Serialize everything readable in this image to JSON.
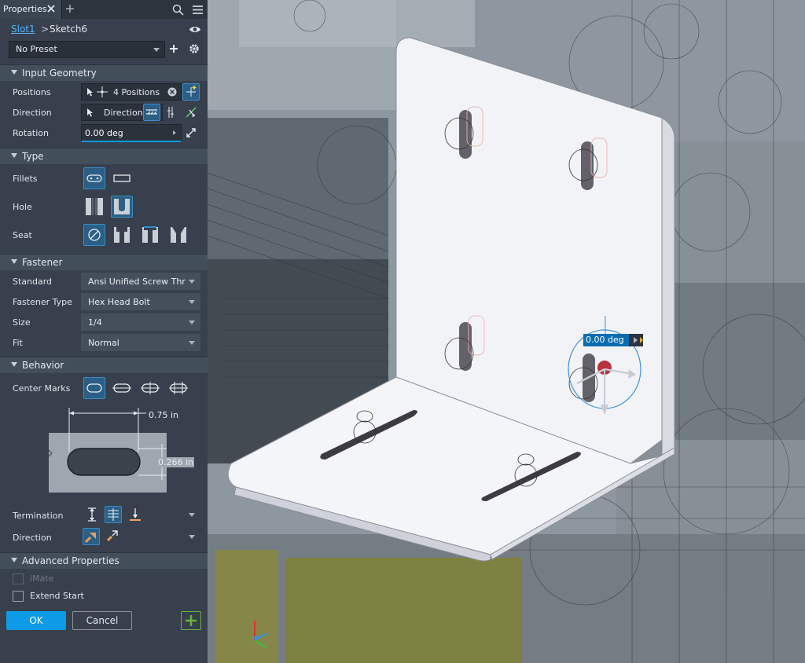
{
  "panel": {
    "tab_title": "Properties",
    "breadcrumb": {
      "item1": "Slot1",
      "separator": ">",
      "item2": "Sketch6"
    },
    "preset": {
      "value": "No Preset"
    }
  },
  "input_geometry": {
    "title": "Input Geometry",
    "positions_label": "Positions",
    "positions_value": "4 Positions",
    "direction_label": "Direction",
    "direction_value": "Direction",
    "rotation_label": "Rotation",
    "rotation_value": "0.00 deg"
  },
  "type": {
    "title": "Type",
    "fillets_label": "Fillets",
    "hole_label": "Hole",
    "seat_label": "Seat"
  },
  "fastener": {
    "title": "Fastener",
    "standard_label": "Standard",
    "standard_value": "Ansi Unified Screw Thre...",
    "fastener_type_label": "Fastener Type",
    "fastener_type_value": "Hex Head Bolt",
    "size_label": "Size",
    "size_value": "1/4",
    "fit_label": "Fit",
    "fit_value": "Normal"
  },
  "behavior": {
    "title": "Behavior",
    "center_marks_label": "Center Marks",
    "dim_width": "0.75 in",
    "dim_height": "0.266 in",
    "termination_label": "Termination",
    "direction_label": "Direction"
  },
  "advanced": {
    "title": "Advanced Properties",
    "imate_label": "iMate",
    "extend_start_label": "Extend Start"
  },
  "footer": {
    "ok_label": "OK",
    "cancel_label": "Cancel"
  },
  "viewport": {
    "rotation_tooltip": "0.00 deg"
  },
  "colors": {
    "accent": "#0d9ae6",
    "panel_bg": "#37404c",
    "add_green": "#6bb33a"
  }
}
